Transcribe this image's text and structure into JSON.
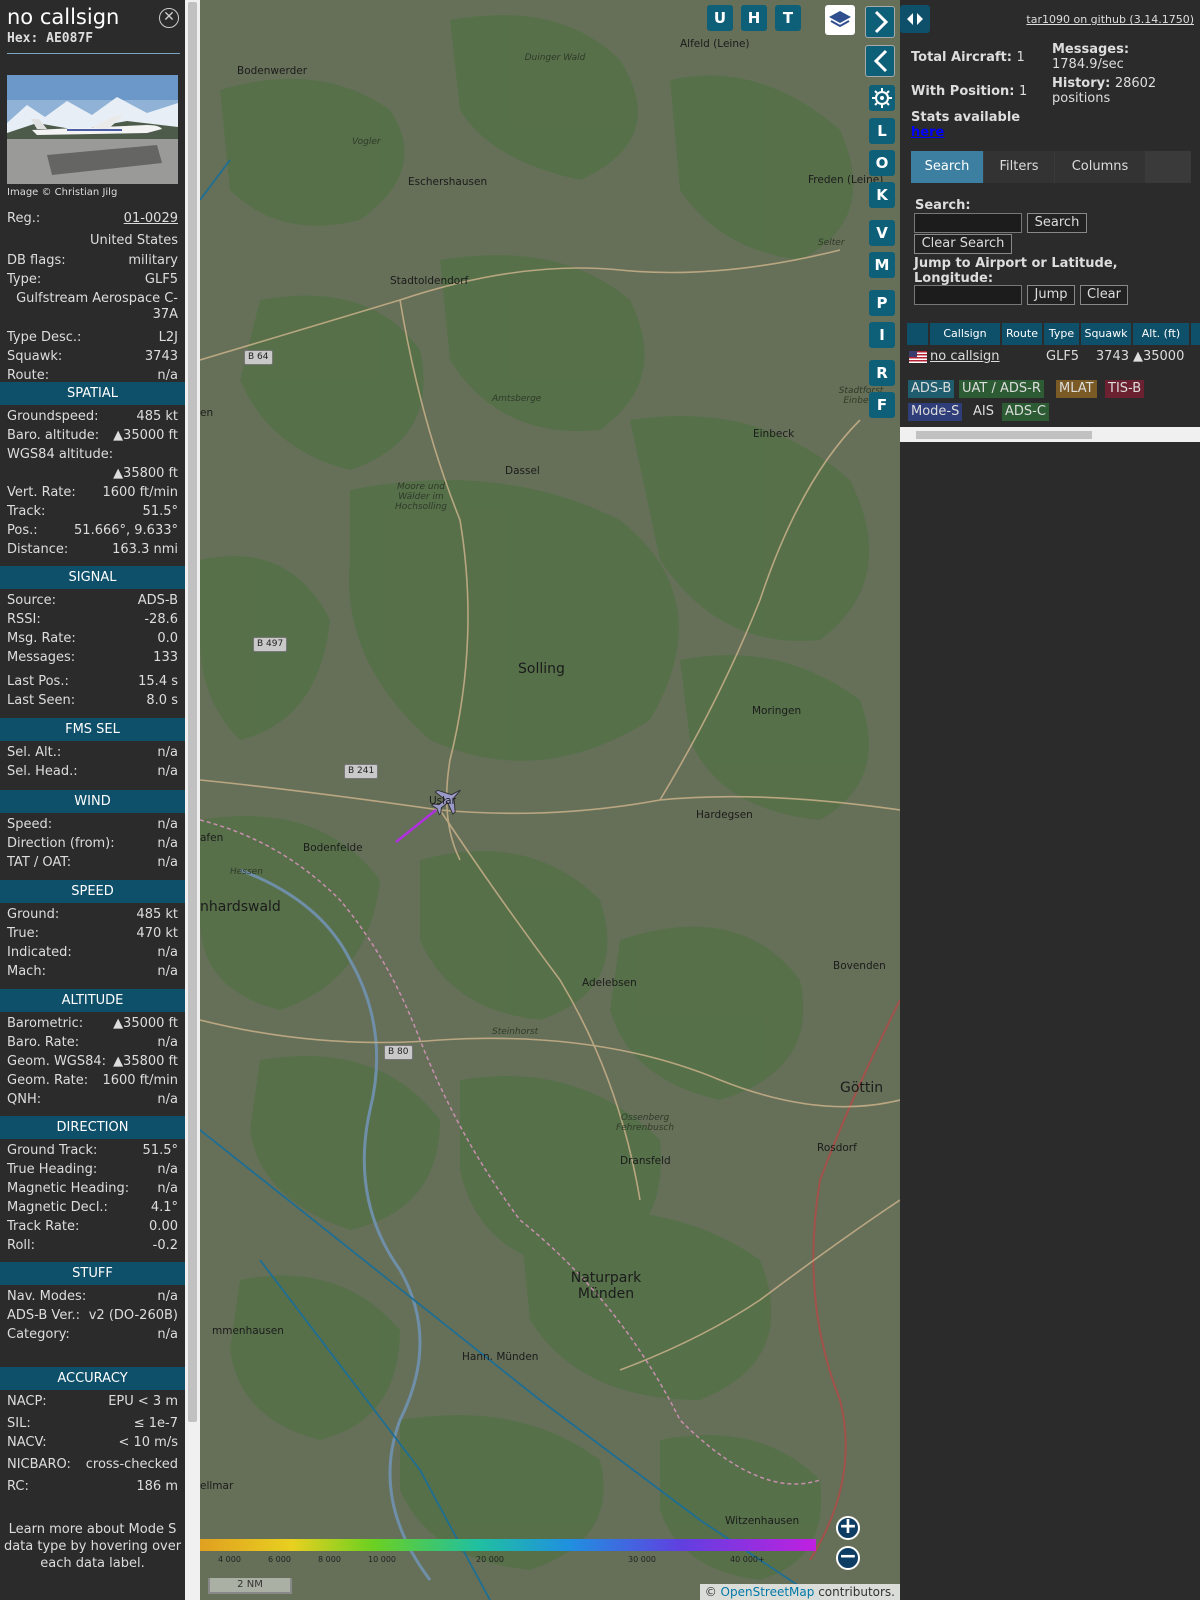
{
  "detail": {
    "callsign": "no callsign",
    "hex_line": "Hex: AE087F",
    "photo_credit": "Image © Christian Jilg",
    "fields": {
      "reg_label": "Reg.:",
      "reg_value": "01-0029",
      "country": "United States",
      "dbflags_label": "DB flags:",
      "dbflags_value": "military",
      "type_label": "Type:",
      "type_value": "GLF5",
      "type_name_1": "Gulfstream Aerospace C-",
      "type_name_2": "37A",
      "typedesc_label": "Type Desc.:",
      "typedesc_value": "L2J",
      "squawk_label": "Squawk:",
      "squawk_value": "3743",
      "route_label": "Route:",
      "route_value": "n/a"
    },
    "sections": {
      "spatial": "SPATIAL",
      "signal": "SIGNAL",
      "fms": "FMS SEL",
      "wind": "WIND",
      "speed": "SPEED",
      "altitude": "ALTITUDE",
      "direction": "DIRECTION",
      "stuff": "STUFF",
      "accuracy": "ACCURACY"
    },
    "spatial": [
      {
        "k": "Groundspeed:",
        "v": "485 kt"
      },
      {
        "k": "Baro. altitude:",
        "v": "▲35000 ft"
      },
      {
        "k": "WGS84 altitude:",
        "v": ""
      },
      {
        "k": "",
        "v": "▲35800 ft"
      },
      {
        "k": "Vert. Rate:",
        "v": "1600 ft/min"
      },
      {
        "k": "Track:",
        "v": "51.5°"
      },
      {
        "k": "Pos.:",
        "v": "51.666°, 9.633°"
      },
      {
        "k": "Distance:",
        "v": "163.3 nmi"
      }
    ],
    "signal": [
      {
        "k": "Source:",
        "v": "ADS-B"
      },
      {
        "k": "RSSI:",
        "v": "-28.6"
      },
      {
        "k": "Msg. Rate:",
        "v": "0.0"
      },
      {
        "k": "Messages:",
        "v": "133"
      },
      {
        "k": "Last Pos.:",
        "v": "15.4 s"
      },
      {
        "k": "Last Seen:",
        "v": "8.0 s"
      }
    ],
    "fms": [
      {
        "k": "Sel. Alt.:",
        "v": "n/a"
      },
      {
        "k": "Sel. Head.:",
        "v": "n/a"
      }
    ],
    "wind": [
      {
        "k": "Speed:",
        "v": "n/a"
      },
      {
        "k": "Direction (from):",
        "v": "n/a"
      },
      {
        "k": "TAT / OAT:",
        "v": "n/a"
      }
    ],
    "speed": [
      {
        "k": "Ground:",
        "v": "485 kt"
      },
      {
        "k": "True:",
        "v": "470 kt"
      },
      {
        "k": "Indicated:",
        "v": "n/a"
      },
      {
        "k": "Mach:",
        "v": "n/a"
      }
    ],
    "altitude": [
      {
        "k": "Barometric:",
        "v": "▲35000 ft"
      },
      {
        "k": "Baro. Rate:",
        "v": "n/a"
      },
      {
        "k": "Geom. WGS84:",
        "v": "▲35800 ft"
      },
      {
        "k": "Geom. Rate:",
        "v": "1600 ft/min"
      },
      {
        "k": "QNH:",
        "v": "n/a"
      }
    ],
    "direction": [
      {
        "k": "Ground Track:",
        "v": "51.5°"
      },
      {
        "k": "True Heading:",
        "v": "n/a"
      },
      {
        "k": "Magnetic Heading:",
        "v": "n/a"
      },
      {
        "k": "Magnetic Decl.:",
        "v": "4.1°"
      },
      {
        "k": "Track Rate:",
        "v": "0.00"
      },
      {
        "k": "Roll:",
        "v": "-0.2"
      }
    ],
    "stuff": [
      {
        "k": "Nav. Modes:",
        "v": "n/a"
      },
      {
        "k": "ADS-B Ver.:",
        "v": "v2 (DO-260B)"
      },
      {
        "k": "Category:",
        "v": "n/a"
      }
    ],
    "accuracy": [
      {
        "k": "NACP:",
        "v": "EPU < 3 m"
      },
      {
        "k": "SIL:",
        "v": "≤ 1e-7"
      },
      {
        "k": "NACV:",
        "v": "< 10 m/s"
      },
      {
        "k": "NICBARO:",
        "v": "cross-checked"
      },
      {
        "k": "RC:",
        "v": "186 m"
      }
    ],
    "footer": "Learn more about Mode S data type by hovering over each data label."
  },
  "map": {
    "buttons_top": [
      "U",
      "H",
      "T"
    ],
    "buttons_side": [
      "L",
      "O",
      "K",
      "V",
      "M",
      "P",
      "I",
      "R",
      "F"
    ],
    "places": [
      {
        "name": "Alfeld (Leine)",
        "cls": ""
      },
      {
        "name": "Bodenwerder",
        "cls": ""
      },
      {
        "name": "Duinger Wald",
        "cls": "it"
      },
      {
        "name": "Vogler",
        "cls": "it"
      },
      {
        "name": "Eschershausen",
        "cls": ""
      },
      {
        "name": "Freden (Leine)",
        "cls": ""
      },
      {
        "name": "Selter",
        "cls": "it"
      },
      {
        "name": "Stadtoldendorf",
        "cls": ""
      },
      {
        "name": "Amtsberge",
        "cls": "it"
      },
      {
        "name": "Stadtforst Einbeck",
        "cls": "it"
      },
      {
        "name": "Einbeck",
        "cls": ""
      },
      {
        "name": "Dassel",
        "cls": ""
      },
      {
        "name": "Moore und Wälder im Hochsolling",
        "cls": "it"
      },
      {
        "name": "Solling",
        "cls": "big"
      },
      {
        "name": "Moringen",
        "cls": ""
      },
      {
        "name": "Uslar",
        "cls": ""
      },
      {
        "name": "Hardegsen",
        "cls": ""
      },
      {
        "name": "Bodenfelde",
        "cls": ""
      },
      {
        "name": "nhardswald",
        "cls": "big"
      },
      {
        "name": "Hessen",
        "cls": "it"
      },
      {
        "name": "Adelebsen",
        "cls": ""
      },
      {
        "name": "Bovenden",
        "cls": ""
      },
      {
        "name": "Steinhorst",
        "cls": "it"
      },
      {
        "name": "Göttin",
        "cls": "big"
      },
      {
        "name": "Ossenberg Fehrenbusch",
        "cls": "it"
      },
      {
        "name": "Dransfeld",
        "cls": ""
      },
      {
        "name": "Rosdorf",
        "cls": ""
      },
      {
        "name": "Naturpark Münden",
        "cls": "big"
      },
      {
        "name": "mmenhausen",
        "cls": ""
      },
      {
        "name": "Hann. Münden",
        "cls": ""
      },
      {
        "name": "ellmar",
        "cls": ""
      },
      {
        "name": "Witzenhausen",
        "cls": ""
      },
      {
        "name": "afen",
        "cls": ""
      },
      {
        "name": "en",
        "cls": ""
      }
    ],
    "roads": [
      "B 64",
      "B 497",
      "B 241",
      "B 80"
    ],
    "altitude_legend": [
      "4 000",
      "6 000",
      "8 000",
      "10 000",
      "20 000",
      "30 000",
      "40 000+"
    ],
    "scale": "2 NM",
    "attribution_prefix": "© ",
    "attribution_link": "OpenStreetMap",
    "attribution_suffix": " contributors."
  },
  "right": {
    "github": "tar1090 on github (3.14.1750)",
    "total_label": "Total Aircraft:",
    "total_value": "1",
    "withpos_label": "With Position:",
    "withpos_value": "1",
    "stats_label": "Stats available",
    "stats_link": "here",
    "messages_label": "Messages:",
    "messages_value": "1784.9/sec",
    "history_label": "History:",
    "history_value": "28602",
    "history_unit": "positions",
    "tabs": [
      "Search",
      "Filters",
      "Columns"
    ],
    "search_label": "Search:",
    "search_button": "Search",
    "clear_search_button": "Clear Search",
    "jump_label_1": "Jump to Airport or Latitude,",
    "jump_label_2": "Longitude:",
    "jump_button": "Jump",
    "clear_button": "Clear",
    "table_headers": [
      "Callsign",
      "Route",
      "Type",
      "Squawk",
      "Alt. (ft)"
    ],
    "table_row": {
      "callsign": "no callsign",
      "route": "",
      "type": "GLF5",
      "squawk": "3743",
      "alt": "▲35000"
    },
    "sources": [
      {
        "label": "ADS-B",
        "bg": "#1f5c6e"
      },
      {
        "label": "UAT / ADS-R",
        "bg": "#2d5b34"
      },
      {
        "label": "MLAT",
        "bg": "#7a5a25"
      },
      {
        "label": "TIS-B",
        "bg": "#6b2130"
      },
      {
        "label": "Mode-S",
        "bg": "#2f3d78"
      },
      {
        "label": "AIS",
        "bg": "#2b2b2b"
      },
      {
        "label": "ADS-C",
        "bg": "#2d5b34"
      }
    ]
  }
}
